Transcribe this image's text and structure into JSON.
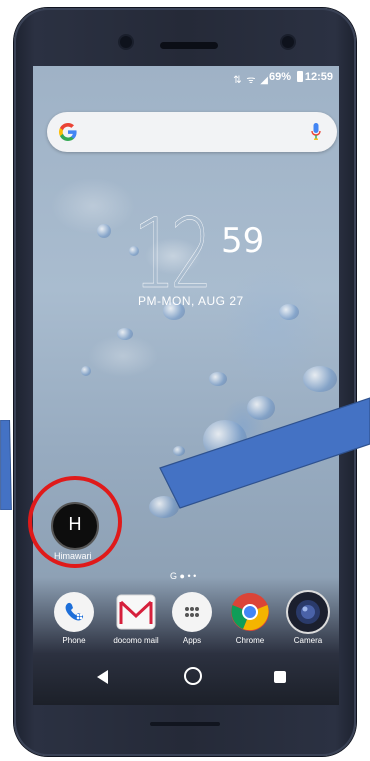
{
  "status_bar": {
    "icons": "⇅ ᯤ ◢",
    "battery_percent": "69%",
    "time": "12:59"
  },
  "search": {
    "logo": "G"
  },
  "lock_clock": {
    "hour": "12",
    "minute": "59",
    "date": "PM-MON, AUG 27"
  },
  "home_apps": [
    {
      "letter": "H",
      "label": "Himawari"
    }
  ],
  "page_dots": "G ● • •",
  "dock": [
    {
      "label": "Phone",
      "icon": "phone-icon"
    },
    {
      "label": "docomo mail",
      "icon": "mail-icon"
    },
    {
      "label": "Apps",
      "icon": "apps-icon"
    },
    {
      "label": "Chrome",
      "icon": "chrome-icon"
    },
    {
      "label": "Camera",
      "icon": "camera-icon"
    }
  ],
  "colors": {
    "highlight_circle": "#e01a1a",
    "annotation_arrow": "#4472c4"
  }
}
